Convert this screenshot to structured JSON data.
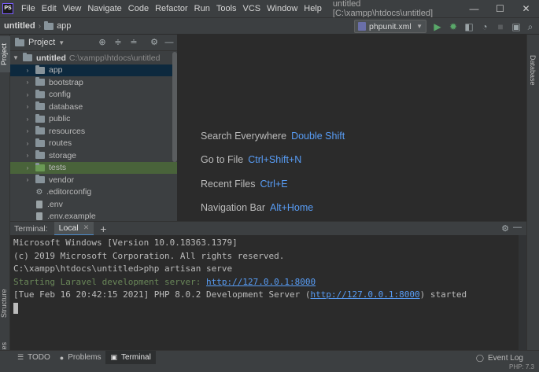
{
  "app": {
    "logo_text": "PS",
    "window_title": "untitled [C:\\xampp\\htdocs\\untitled]"
  },
  "menu": [
    "File",
    "Edit",
    "View",
    "Navigate",
    "Code",
    "Refactor",
    "Run",
    "Tools",
    "VCS",
    "Window",
    "Help"
  ],
  "window_controls": {
    "minimize": "—",
    "maximize": "☐",
    "close": "✕"
  },
  "breadcrumb": {
    "project": "untitled",
    "folder": "app"
  },
  "toolbar": {
    "run_config": "phpunit.xml",
    "icons": [
      "run-icon",
      "debug-icon",
      "coverage-icon",
      "profile-icon",
      "stop-icon",
      "window-icon",
      "search-icon"
    ]
  },
  "project_panel": {
    "title": "Project",
    "root": {
      "name": "untitled",
      "path": "C:\\xampp\\htdocs\\untitled"
    },
    "items": [
      {
        "label": "app",
        "type": "folder"
      },
      {
        "label": "bootstrap",
        "type": "folder"
      },
      {
        "label": "config",
        "type": "folder"
      },
      {
        "label": "database",
        "type": "folder"
      },
      {
        "label": "public",
        "type": "folder"
      },
      {
        "label": "resources",
        "type": "folder"
      },
      {
        "label": "routes",
        "type": "folder"
      },
      {
        "label": "storage",
        "type": "folder"
      },
      {
        "label": "tests",
        "type": "folder"
      },
      {
        "label": "vendor",
        "type": "folder"
      },
      {
        "label": ".editorconfig",
        "type": "config-file"
      },
      {
        "label": ".env",
        "type": "file"
      },
      {
        "label": ".env.example",
        "type": "file"
      }
    ]
  },
  "side_tabs": {
    "left": [
      "Project",
      "Structure",
      "Favorites"
    ],
    "right": [
      "Database"
    ]
  },
  "editor_hints": [
    {
      "label": "Search Everywhere",
      "key": "Double Shift"
    },
    {
      "label": "Go to File",
      "key": "Ctrl+Shift+N"
    },
    {
      "label": "Recent Files",
      "key": "Ctrl+E"
    },
    {
      "label": "Navigation Bar",
      "key": "Alt+Home"
    }
  ],
  "terminal": {
    "label": "Terminal:",
    "tab": "Local",
    "lines": {
      "l1": "Microsoft Windows [Version 10.0.18363.1379]",
      "l2": "(c) 2019 Microsoft Corporation. All rights reserved.",
      "l3": "C:\\xampp\\htdocs\\untitled>php artisan serve",
      "l4_prefix": "Starting Laravel development server: ",
      "l4_link": "http://127.0.0.1:8000",
      "l5_prefix": "[Tue Feb 16 20:42:15 2021] PHP 8.0.2 Development Server (",
      "l5_link": "http://127.0.0.1:8000",
      "l5_suffix": ") started"
    }
  },
  "bottom_tabs": [
    {
      "label": "TODO",
      "icon": "list-icon"
    },
    {
      "label": "Problems",
      "icon": "problems-icon"
    },
    {
      "label": "Terminal",
      "icon": "terminal-icon",
      "active": true
    }
  ],
  "event_log": "Event Log",
  "status": {
    "php": "PHP: 7.3"
  },
  "colors": {
    "accent": "#589df6",
    "selection": "#0d293e",
    "tests_highlight": "#49633a",
    "terminal_green": "#6a8759"
  }
}
